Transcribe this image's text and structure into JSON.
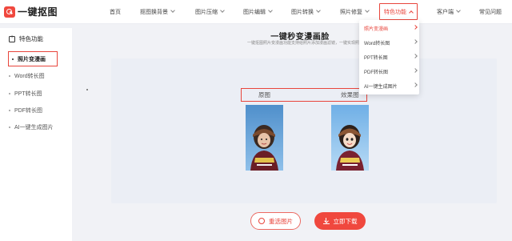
{
  "header": {
    "logo_text": "一键抠图",
    "nav": [
      {
        "label": "首页",
        "has_caret": false
      },
      {
        "label": "抠图换背景",
        "has_caret": true
      },
      {
        "label": "图片压缩",
        "has_caret": true
      },
      {
        "label": "图片编辑",
        "has_caret": true
      },
      {
        "label": "图片转换",
        "has_caret": true
      },
      {
        "label": "照片修复",
        "has_caret": true
      },
      {
        "label": "特色功能",
        "has_caret": true,
        "active": true
      },
      {
        "label": "客户端",
        "has_caret": true
      },
      {
        "label": "常见问题",
        "has_caret": false
      }
    ]
  },
  "dropdown": {
    "items": [
      {
        "label": "照片变漫画",
        "active": true
      },
      {
        "label": "Word转长图",
        "active": false
      },
      {
        "label": "PPT转长图",
        "active": false
      },
      {
        "label": "PDF转长图",
        "active": false
      },
      {
        "label": "AI一键生成图片",
        "active": false
      }
    ]
  },
  "sidebar": {
    "title": "特色功能",
    "items": [
      {
        "label": "照片变漫画",
        "active": true
      },
      {
        "label": "Word转长图",
        "active": false
      },
      {
        "label": "PPT转长图",
        "active": false
      },
      {
        "label": "PDF转长图",
        "active": false
      },
      {
        "label": "AI一键生成图片",
        "active": false
      }
    ]
  },
  "main": {
    "title": "一键秒变漫画脸",
    "subtitle": "一键抠图照片变漫画功能支持给照片添加漫画滤镜，一键实现照片",
    "compare": {
      "original_label": "原图",
      "result_label": "效果图"
    },
    "buttons": {
      "reselect": "重选图片",
      "download": "立即下载"
    }
  },
  "colors": {
    "accent": "#e8453c",
    "sky_original": "#5b97cf",
    "sky_result": "#7ab6e8"
  }
}
